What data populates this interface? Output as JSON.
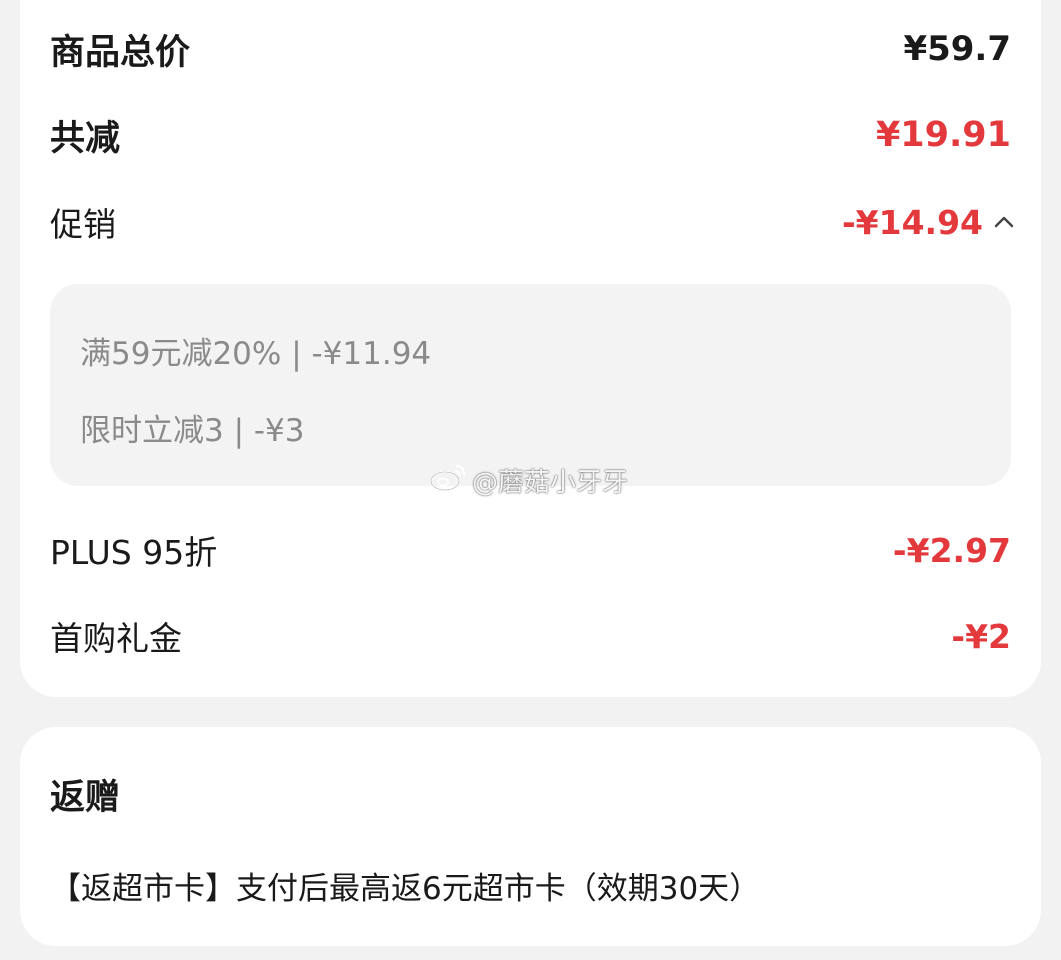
{
  "price_card": {
    "total": {
      "label": "商品总价",
      "value": "¥59.7"
    },
    "discount_total": {
      "label": "共减",
      "value": "¥19.91",
      "color": "#e4393c"
    },
    "promotion": {
      "label": "促销",
      "value": "-¥14.94",
      "expanded": true,
      "icon": "chevron-up-icon",
      "details": [
        "满59元减20% | -¥11.94",
        "限时立减3 | -¥3"
      ]
    },
    "plus": {
      "label": "PLUS 95折",
      "value": "-¥2.97"
    },
    "first_purchase": {
      "label": "首购礼金",
      "value": "-¥2"
    }
  },
  "watermark": {
    "text": "@蘑菇小牙牙",
    "icon": "weibo-icon"
  },
  "rebate_card": {
    "title": "返赠",
    "text": "【返超市卡】支付后最高返6元超市卡（效期30天）"
  },
  "colors": {
    "accent_red": "#e4393c",
    "muted_text": "#8a8a8a",
    "background": "#f2f2f2",
    "card": "#ffffff"
  }
}
